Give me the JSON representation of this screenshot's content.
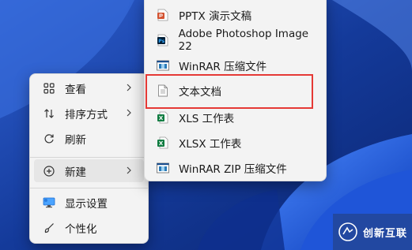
{
  "context_menu": {
    "items": [
      {
        "label": "查看",
        "icon": "grid-icon",
        "has_submenu": true
      },
      {
        "label": "排序方式",
        "icon": "sort-icon",
        "has_submenu": true
      },
      {
        "label": "刷新",
        "icon": "refresh-icon",
        "has_submenu": false
      },
      {
        "label": "新建",
        "icon": "plus-circle-icon",
        "has_submenu": true,
        "active": true
      },
      {
        "label": "显示设置",
        "icon": "display-icon",
        "has_submenu": false
      },
      {
        "label": "个性化",
        "icon": "brush-icon",
        "has_submenu": false
      }
    ]
  },
  "new_submenu": {
    "items": [
      {
        "label": "PPTX 演示文稿",
        "icon": "powerpoint-icon"
      },
      {
        "label": "Adobe Photoshop Image 22",
        "icon": "photoshop-icon"
      },
      {
        "label": "WinRAR 压缩文件",
        "icon": "winrar-icon"
      },
      {
        "label": "文本文档",
        "icon": "text-document-icon",
        "highlighted": true
      },
      {
        "label": "XLS 工作表",
        "icon": "excel-icon"
      },
      {
        "label": "XLSX 工作表",
        "icon": "excel-icon"
      },
      {
        "label": "WinRAR ZIP 压缩文件",
        "icon": "winrar-zip-icon"
      }
    ]
  },
  "watermark": {
    "text": "创新互联"
  },
  "colors": {
    "highlight_border": "#e53935",
    "menu_bg": "#f3f3f3",
    "wallpaper": "#1a3f9e"
  }
}
